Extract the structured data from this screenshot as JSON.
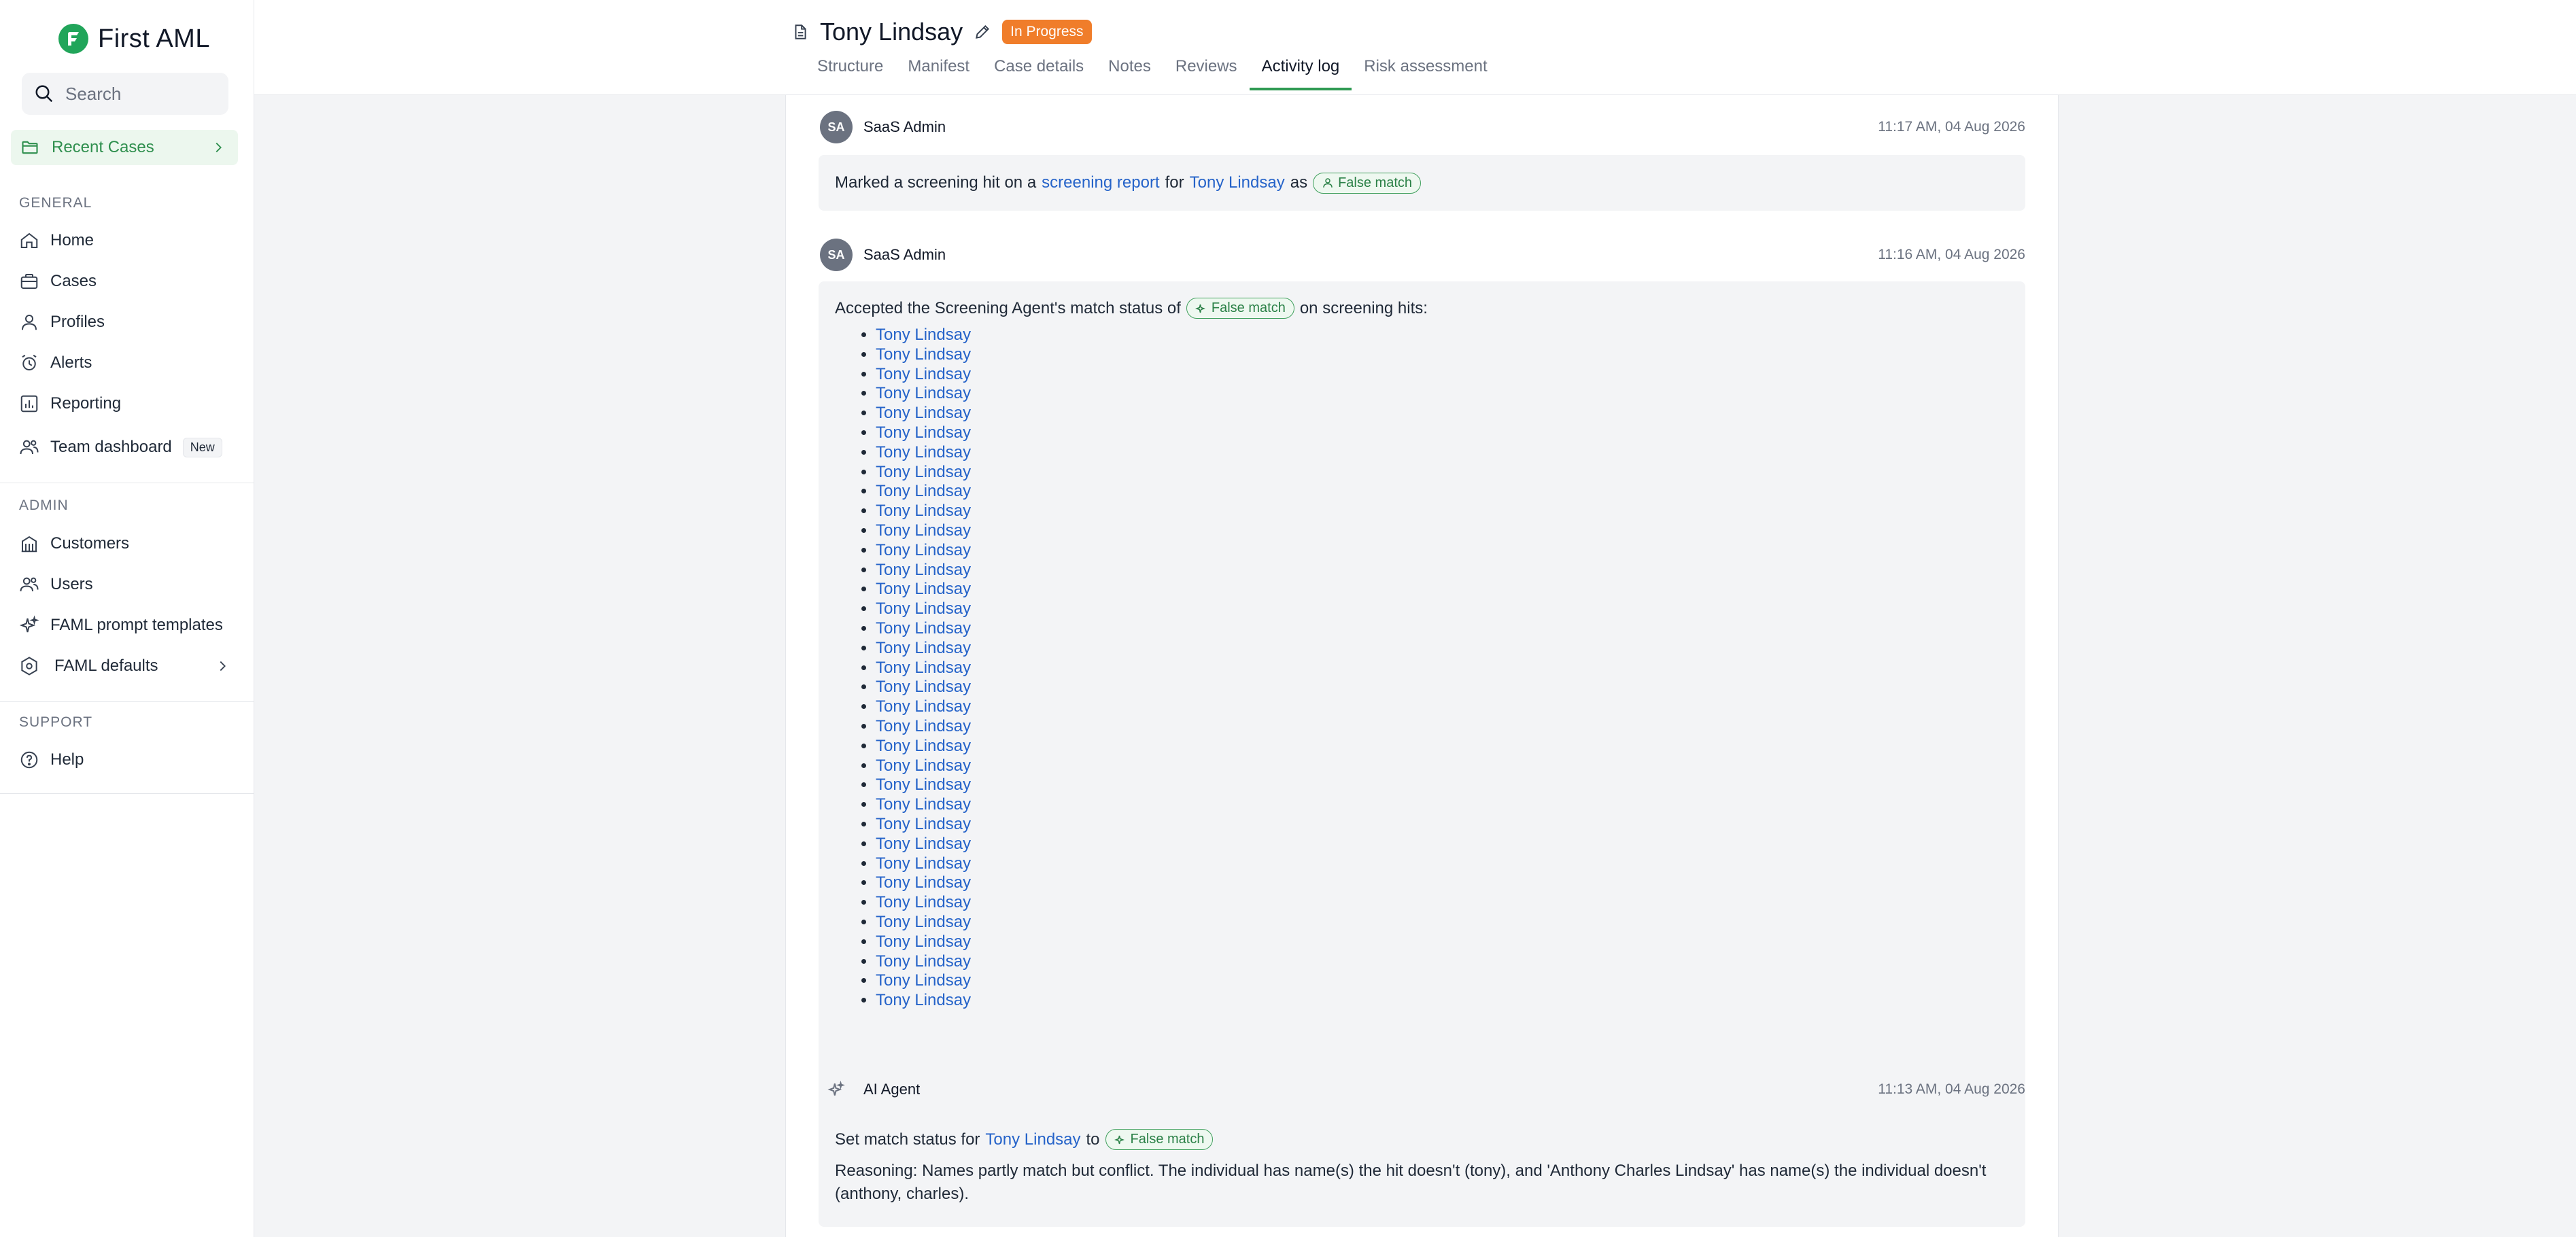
{
  "brand": {
    "name": "First AML",
    "color": "#21a55a"
  },
  "sidebar": {
    "search_placeholder": "Search",
    "recent_cases": "Recent Cases",
    "sections": {
      "general": "GENERAL",
      "admin": "ADMIN",
      "support": "SUPPORT"
    },
    "general_items": [
      {
        "label": "Home",
        "icon": "home-icon"
      },
      {
        "label": "Cases",
        "icon": "briefcase-icon"
      },
      {
        "label": "Profiles",
        "icon": "user-icon"
      },
      {
        "label": "Alerts",
        "icon": "alarm-clock-icon"
      },
      {
        "label": "Reporting",
        "icon": "report-chart-icon"
      },
      {
        "label": "Team dashboard",
        "icon": "team-icon",
        "badge": "New"
      }
    ],
    "admin_items": [
      {
        "label": "Customers",
        "icon": "building-icon"
      },
      {
        "label": "Users",
        "icon": "users-icon"
      },
      {
        "label": "FAML prompt templates",
        "icon": "sparkle-icon"
      },
      {
        "label": "FAML defaults",
        "icon": "settings-hex-icon"
      }
    ],
    "support_items": [
      {
        "label": "Help",
        "icon": "help-circle-icon"
      }
    ]
  },
  "header": {
    "case_name": "Tony Lindsay",
    "status": "In Progress",
    "status_color": "#f07d2a",
    "tabs": [
      "Structure",
      "Manifest",
      "Case details",
      "Notes",
      "Reviews",
      "Activity log",
      "Risk assessment"
    ],
    "active_tab": "Activity log"
  },
  "activity": [
    {
      "author_initials": "SA",
      "author": "SaaS Admin",
      "time": "11:17 AM, 04 Aug 2026",
      "text_1": "Marked a screening hit on a",
      "link_1": "screening report",
      "text_2": "for",
      "link_2": "Tony Lindsay",
      "text_3": "as",
      "pill": "False match"
    },
    {
      "author_initials": "SA",
      "author": "SaaS Admin",
      "time": "11:16 AM, 04 Aug 2026",
      "text_1": "Accepted the Screening Agent's match status of",
      "pill": "False match",
      "text_2": "on screening hits:",
      "hits": [
        "Tony Lindsay",
        "Tony Lindsay",
        "Tony Lindsay",
        "Tony Lindsay",
        "Tony Lindsay",
        "Tony Lindsay",
        "Tony Lindsay",
        "Tony Lindsay",
        "Tony Lindsay",
        "Tony Lindsay",
        "Tony Lindsay",
        "Tony Lindsay",
        "Tony Lindsay",
        "Tony Lindsay",
        "Tony Lindsay",
        "Tony Lindsay",
        "Tony Lindsay",
        "Tony Lindsay",
        "Tony Lindsay",
        "Tony Lindsay",
        "Tony Lindsay",
        "Tony Lindsay",
        "Tony Lindsay",
        "Tony Lindsay",
        "Tony Lindsay",
        "Tony Lindsay",
        "Tony Lindsay",
        "Tony Lindsay",
        "Tony Lindsay",
        "Tony Lindsay",
        "Tony Lindsay",
        "Tony Lindsay",
        "Tony Lindsay",
        "Tony Lindsay",
        "Tony Lindsay"
      ]
    },
    {
      "author": "AI Agent",
      "time": "11:13 AM, 04 Aug 2026",
      "text_1": "Set match status for",
      "link_1": "Tony Lindsay",
      "text_2": "to",
      "pill": "False match",
      "reasoning": "Reasoning: Names partly match but conflict. The individual has name(s) the hit doesn't (tony), and 'Anthony Charles Lindsay' has name(s) the individual doesn't (anthony, charles)."
    }
  ]
}
